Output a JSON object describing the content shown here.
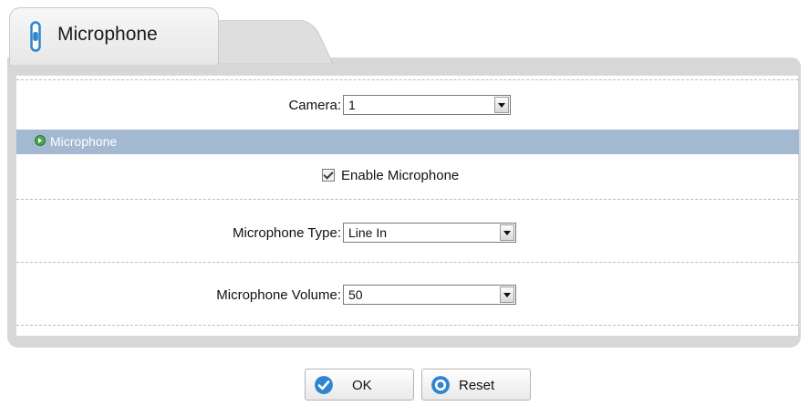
{
  "tab": {
    "title": "Microphone"
  },
  "camera": {
    "label": "Camera:",
    "value": "1"
  },
  "section": {
    "label": "Microphone"
  },
  "enable": {
    "label": "Enable Microphone",
    "checked": true
  },
  "mic_type": {
    "label": "Microphone Type:",
    "value": "Line In"
  },
  "mic_volume": {
    "label": "Microphone Volume:",
    "value": "50"
  },
  "buttons": {
    "ok": "OK",
    "reset": "Reset"
  },
  "colors": {
    "section_bar": "#a3b9d1",
    "tab_icon": "#2f86cf",
    "ok_icon": "#2f86cf",
    "reset_icon": "#2f86cf"
  }
}
